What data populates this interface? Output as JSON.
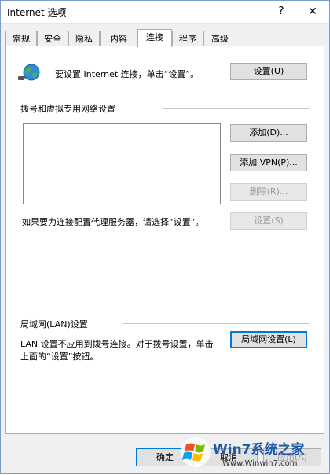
{
  "window": {
    "title": "Internet 选项",
    "help_glyph": "?",
    "close_glyph": "✕"
  },
  "tabs": [
    {
      "label": "常规"
    },
    {
      "label": "安全"
    },
    {
      "label": "隐私"
    },
    {
      "label": "内容"
    },
    {
      "label": "连接"
    },
    {
      "label": "程序"
    },
    {
      "label": "高级"
    }
  ],
  "active_tab": "连接",
  "setup": {
    "description": "要设置 Internet 连接，单击“设置”。",
    "button": "设置(U)"
  },
  "dialup": {
    "section_title": "拨号和虚拟专用网络设置",
    "add_button": "添加(D)...",
    "add_vpn_button": "添加 VPN(P)...",
    "delete_button": "删除(R)...",
    "proxy_hint": "如果要为连接配置代理服务器，请选择“设置”。",
    "settings_button": "设置(S)"
  },
  "lan": {
    "section_title": "局域网(LAN)设置",
    "description_line1": "LAN 设置不应用到拨号连接。对于拨号设置，单击",
    "description_line2": "上面的“设置”按钮。",
    "button": "局域网设置(L)"
  },
  "footer": {
    "ok": "确定",
    "cancel": "取消",
    "apply": "应用(A)"
  },
  "watermark": {
    "brand": "Win7系统之家",
    "url": "Www.Winwin7.com"
  },
  "colors": {
    "accent": "#0078d7",
    "window_border": "#7a9cc7"
  }
}
